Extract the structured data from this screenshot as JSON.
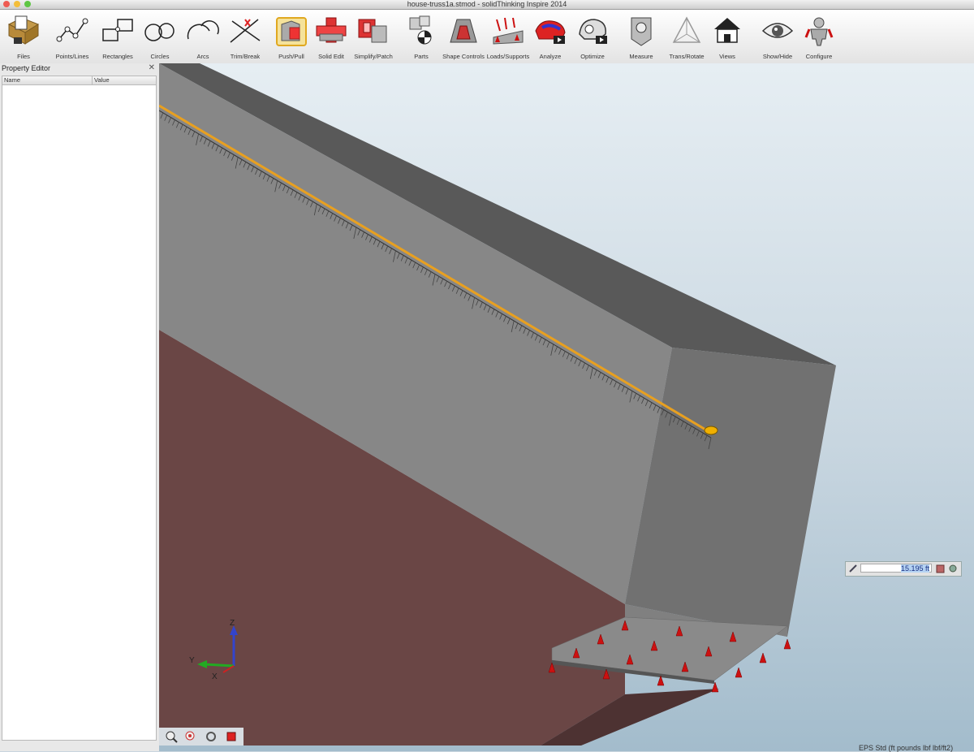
{
  "window": {
    "title": "house-truss1a.stmod - solidThinking Inspire 2014"
  },
  "toolbar": {
    "tools": [
      {
        "label": "Files",
        "icon": "files-icon"
      },
      {
        "label": "Points/Lines",
        "icon": "points-lines-icon"
      },
      {
        "label": "Rectangles",
        "icon": "rectangles-icon"
      },
      {
        "label": "Circles",
        "icon": "circles-icon"
      },
      {
        "label": "Arcs",
        "icon": "arcs-icon"
      },
      {
        "label": "Trim/Break",
        "icon": "trim-break-icon"
      },
      {
        "label": "Push/Pull",
        "icon": "push-pull-icon"
      },
      {
        "label": "Solid Edit",
        "icon": "solid-edit-icon"
      },
      {
        "label": "Simplify/Patch",
        "icon": "simplify-patch-icon"
      },
      {
        "label": "Parts",
        "icon": "parts-icon"
      },
      {
        "label": "Shape Controls",
        "icon": "shape-controls-icon"
      },
      {
        "label": "Loads/Supports",
        "icon": "loads-supports-icon"
      },
      {
        "label": "Analyze",
        "icon": "analyze-icon"
      },
      {
        "label": "Optimize",
        "icon": "optimize-icon"
      },
      {
        "label": "Measure",
        "icon": "measure-icon"
      },
      {
        "label": "Trans/Rotate",
        "icon": "trans-rotate-icon"
      },
      {
        "label": "Views",
        "icon": "views-icon"
      },
      {
        "label": "Show/Hide",
        "icon": "show-hide-icon"
      },
      {
        "label": "Configure",
        "icon": "configure-icon"
      }
    ]
  },
  "property_editor": {
    "title": "Property Editor",
    "columns": [
      "Name",
      "Value"
    ]
  },
  "measurement": {
    "value": "15.195 ft"
  },
  "triad": {
    "z": "Z",
    "y": "Y",
    "x": "X"
  },
  "status": {
    "units": "EPS Std (ft pounds lbf lbf/ft2)"
  },
  "colors": {
    "accent": "#e8a020",
    "support": "#cc1111"
  }
}
